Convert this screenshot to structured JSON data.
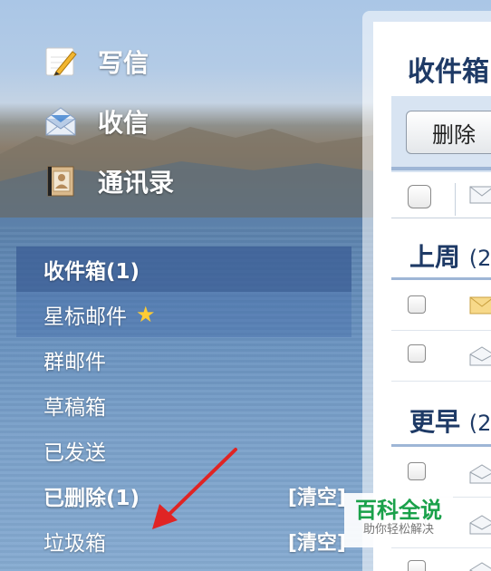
{
  "actions": {
    "write": "写信",
    "receive": "收信",
    "contacts": "通讯录"
  },
  "folders": [
    {
      "label": "收件箱(1)",
      "state": "selected"
    },
    {
      "label": "星标邮件",
      "state": "hover",
      "icon": "star-icon"
    },
    {
      "label": "群邮件"
    },
    {
      "label": "草稿箱"
    },
    {
      "label": "已发送"
    },
    {
      "label": "已删除(1)",
      "action": "[清空]"
    },
    {
      "label": "垃圾箱",
      "action": "[清空]"
    }
  ],
  "panel": {
    "title": "收件箱",
    "delete_label": "删除",
    "groups": [
      {
        "label": "上周",
        "count": "(2"
      },
      {
        "label": "更早",
        "count": "(2"
      }
    ]
  },
  "watermark": {
    "title": "百科全说",
    "subtitle": "助你轻松解决"
  },
  "colors": {
    "selected_bg": "#3c5f96",
    "star": "#ffcc33",
    "title_text": "#1e3a66",
    "watermark_green": "#1aa14a"
  }
}
